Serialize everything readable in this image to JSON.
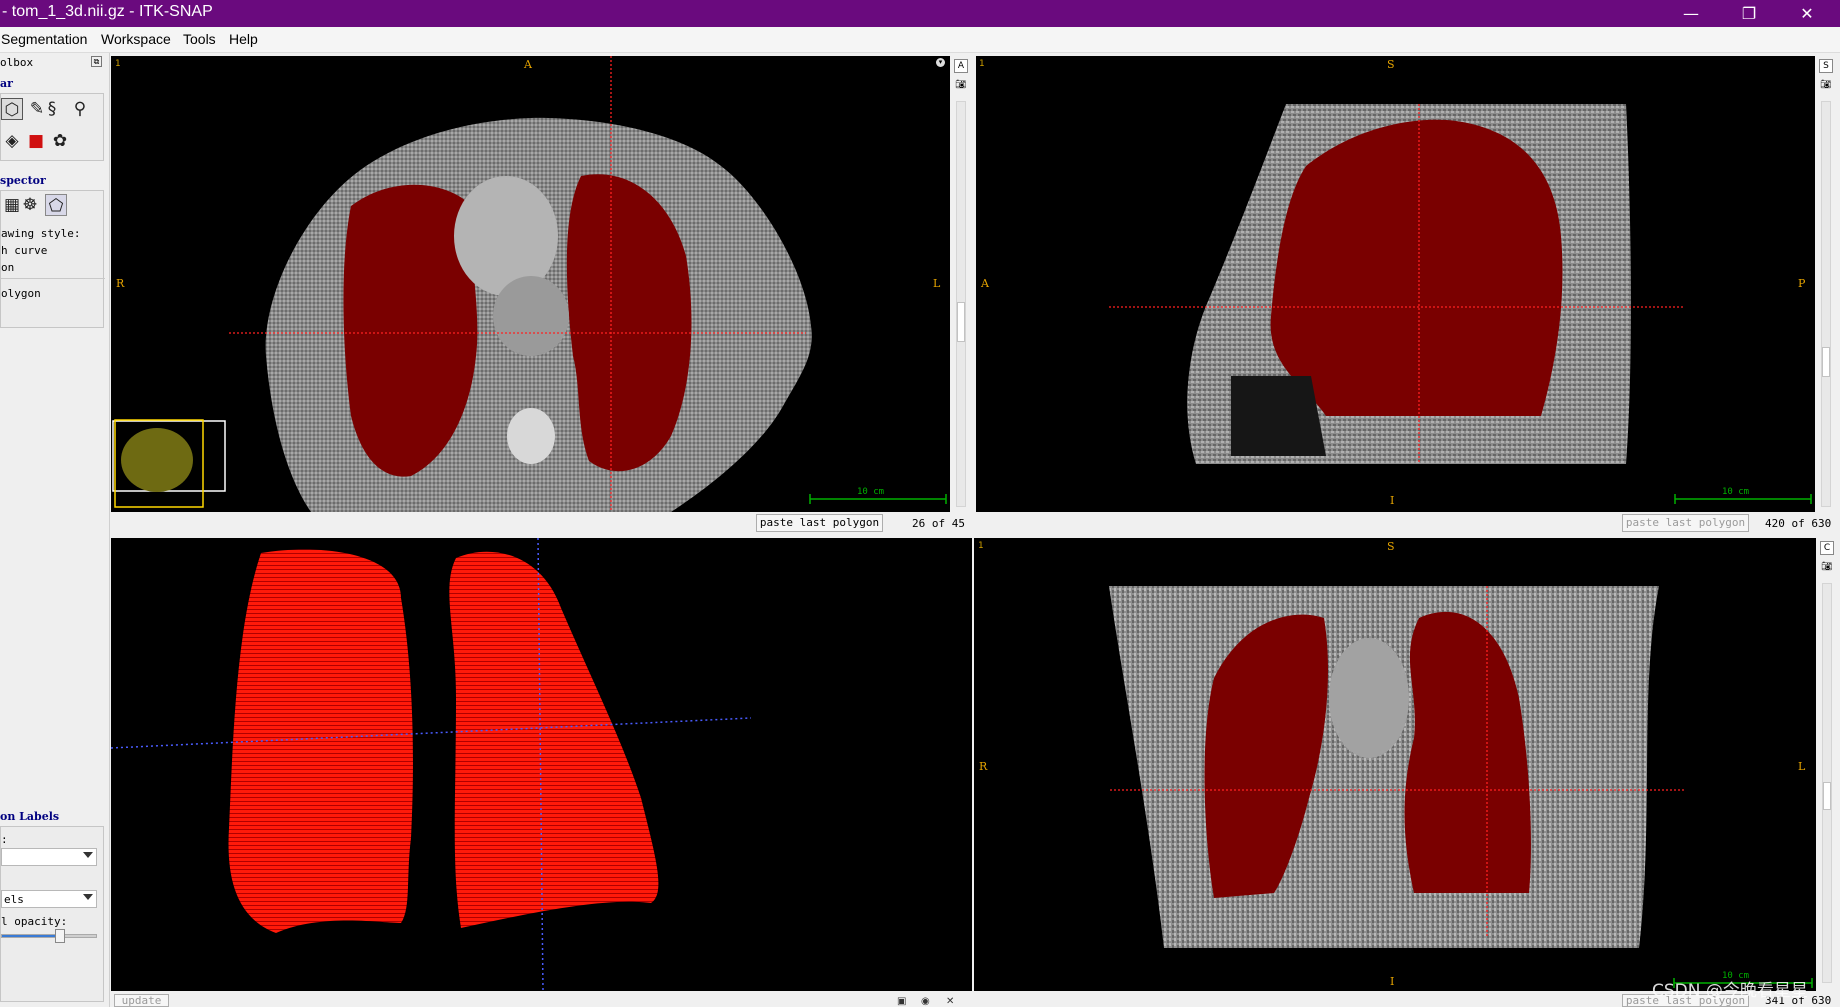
{
  "window": {
    "title": "- tom_1_3d.nii.gz - ITK-SNAP",
    "controls": {
      "minimize": "—",
      "restore": "❐",
      "close": "✕"
    }
  },
  "menubar": [
    "Segmentation",
    "Workspace",
    "Tools",
    "Help"
  ],
  "toolbox": {
    "title": "olbox",
    "toolbar_label": "ar",
    "inspector_label": "spector",
    "drawing_style_label": "awing style:",
    "option_curve": "h curve",
    "option_on": "on",
    "option_polygon": "olygon",
    "labels_heading": "on Labels",
    "label_field_caption": ":",
    "label_select_value": "",
    "els_select_value": "els",
    "opacity_label": "l opacity:",
    "opacity_fraction": 0.6
  },
  "views": {
    "axial": {
      "index": "1",
      "top": "A",
      "left": "R",
      "right": "L",
      "scale_label": "10 cm",
      "paste_button": "paste last polygon",
      "slice": "26 of 45"
    },
    "sagittal": {
      "index": "1",
      "top": "S",
      "left": "A",
      "right": "P",
      "bottom": "I",
      "scale_label": "10 cm",
      "paste_button": "paste last polygon",
      "slice": "420 of 630"
    },
    "render3d": {
      "update_button": "update"
    },
    "coronal": {
      "index": "1",
      "top": "S",
      "left": "R",
      "right": "L",
      "bottom": "I",
      "scale_label": "10 cm",
      "paste_button": "paste last polygon",
      "slice": "341 of 630"
    }
  },
  "side_buttons": {
    "axial": "A",
    "sagittal": "S",
    "coronal": "C"
  },
  "watermark": "CSDN @今晚看星星",
  "colors": {
    "titlebar": "#6a0a7e",
    "segmentation": "#7a0000",
    "mesh": "#ff1a0a",
    "crosshair": "#ff2020",
    "orientation": "#e6a400"
  }
}
